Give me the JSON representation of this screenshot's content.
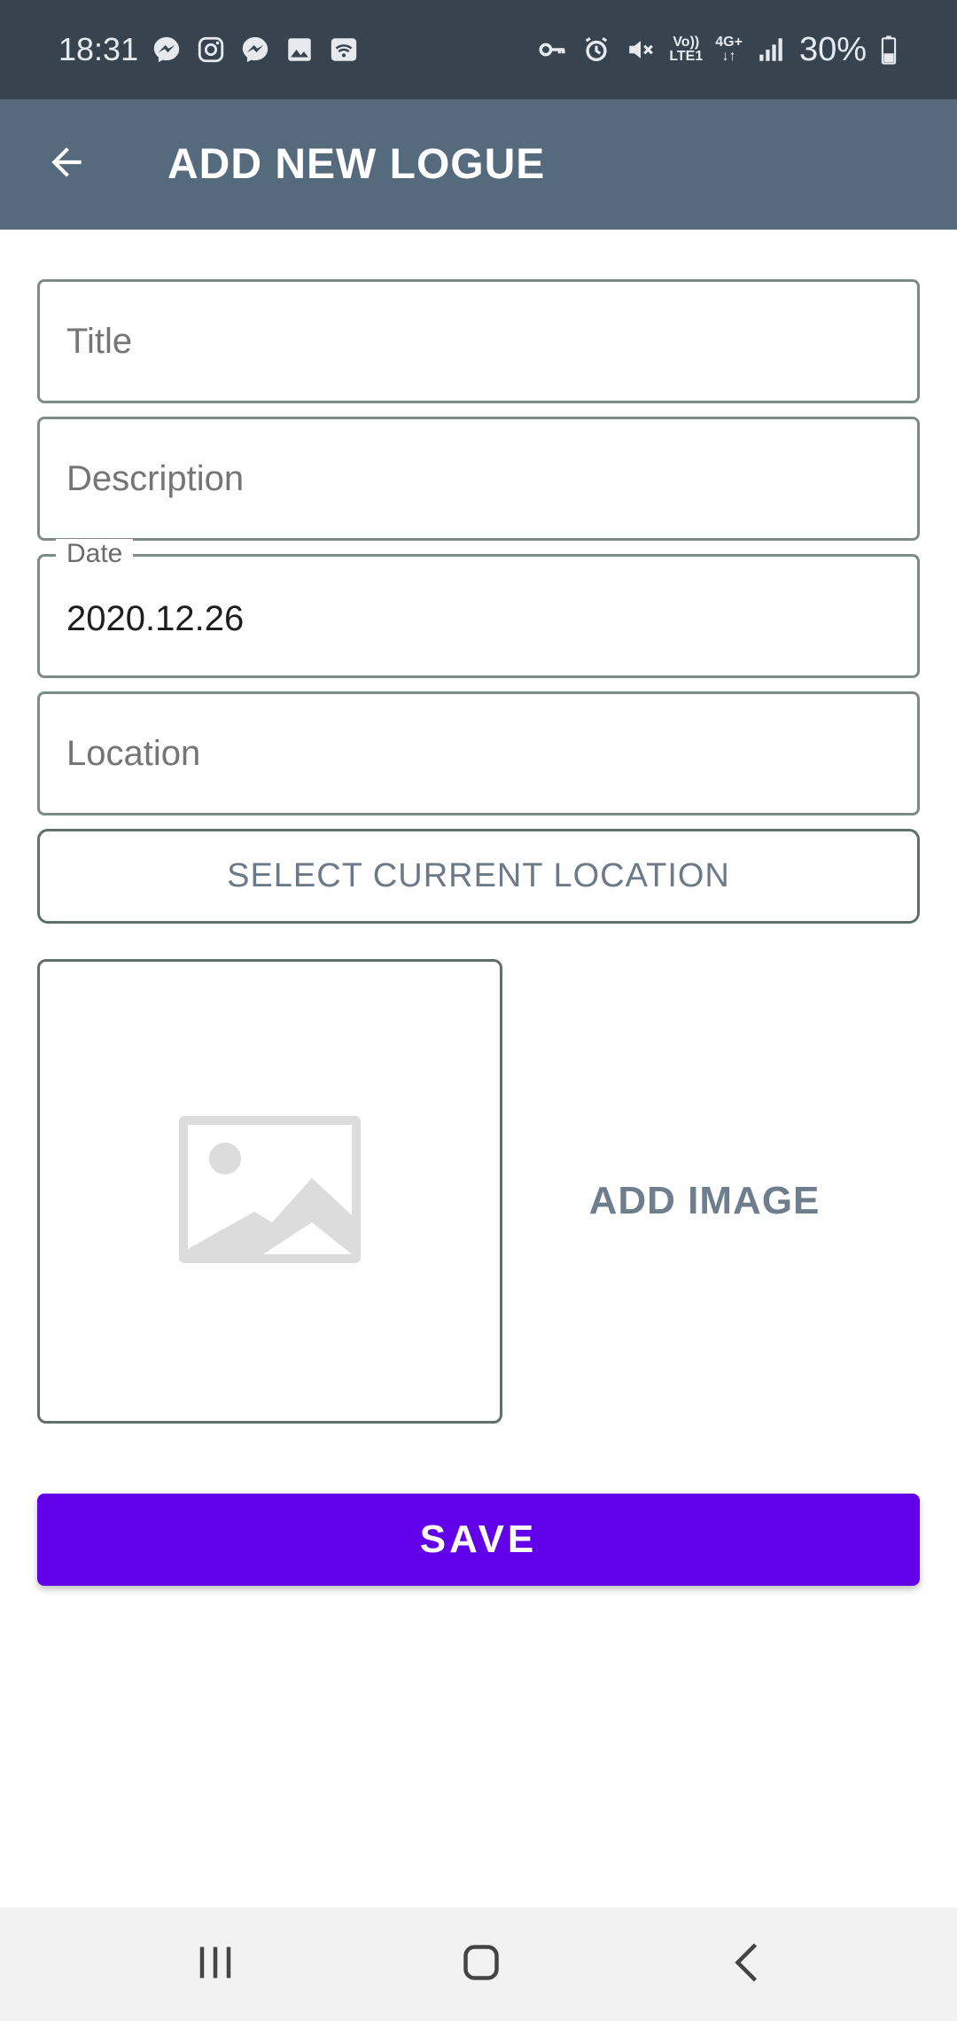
{
  "status_bar": {
    "time": "18:31",
    "network": "4G+",
    "lte": "LTE1",
    "volte": "Vo))",
    "battery": "30%",
    "icons": [
      "messenger-icon",
      "instagram-icon",
      "messenger-icon",
      "gallery-icon",
      "wifi-icon",
      "key-icon",
      "alarm-icon",
      "mute-icon",
      "signal-icon",
      "battery-icon"
    ]
  },
  "toolbar": {
    "back_icon": "arrow-back-icon",
    "title": "ADD NEW LOGUE"
  },
  "form": {
    "title": {
      "placeholder": "Title",
      "value": ""
    },
    "description": {
      "placeholder": "Description",
      "value": ""
    },
    "date": {
      "label": "Date",
      "value": "2020.12.26"
    },
    "location": {
      "placeholder": "Location",
      "value": ""
    },
    "select_location_label": "SELECT CURRENT LOCATION",
    "image_placeholder_icon": "image-placeholder-icon",
    "add_image_label": "ADD IMAGE",
    "save_label": "SAVE"
  },
  "colors": {
    "status_bar": "#37444f",
    "toolbar": "#556a7c",
    "save_button": "#6200ea",
    "nav_bar": "#f2f2f2"
  },
  "nav_bar": {
    "icons": [
      "recent-apps-icon",
      "home-icon",
      "back-icon"
    ]
  }
}
